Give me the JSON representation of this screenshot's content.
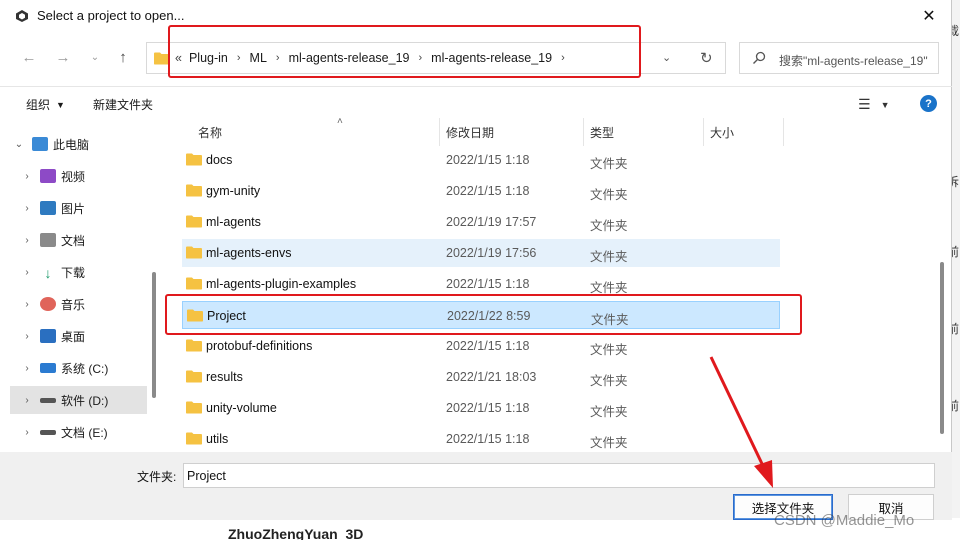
{
  "window": {
    "title": "Select a project to open..."
  },
  "address": {
    "lead": "«",
    "crumbs": [
      "Plug-in",
      "ML",
      "ml-agents-release_19",
      "ml-agents-release_19"
    ]
  },
  "search": {
    "placeholder": "搜索\"ml-agents-release_19\""
  },
  "toolbar": {
    "organize": "组织",
    "new_folder": "新建文件夹"
  },
  "navpane": {
    "items": [
      {
        "label": "此电脑",
        "icon": "computer-icon",
        "color": "#3a8ad6"
      },
      {
        "label": "视频",
        "icon": "video-icon",
        "color": "#8d4ac6"
      },
      {
        "label": "图片",
        "icon": "picture-icon",
        "color": "#2e7ac0"
      },
      {
        "label": "文档",
        "icon": "document-icon",
        "color": "#8a8a8a"
      },
      {
        "label": "下载",
        "icon": "download-icon",
        "color": "#1c9a6a"
      },
      {
        "label": "音乐",
        "icon": "music-icon",
        "color": "#e0645a"
      },
      {
        "label": "桌面",
        "icon": "desktop-icon",
        "color": "#2a6fc0"
      },
      {
        "label": "系统 (C:)",
        "icon": "drive-c-icon",
        "color": "#2b7bd1"
      },
      {
        "label": "软件 (D:)",
        "icon": "drive-d-icon",
        "color": "#555555"
      },
      {
        "label": "文档 (E:)",
        "icon": "drive-e-icon",
        "color": "#555555"
      }
    ]
  },
  "columns": {
    "name": "名称",
    "date": "修改日期",
    "type": "类型",
    "size": "大小"
  },
  "files": [
    {
      "name": "docs",
      "date": "2022/1/15 1:18",
      "type": "文件夹"
    },
    {
      "name": "gym-unity",
      "date": "2022/1/15 1:18",
      "type": "文件夹"
    },
    {
      "name": "ml-agents",
      "date": "2022/1/19 17:57",
      "type": "文件夹"
    },
    {
      "name": "ml-agents-envs",
      "date": "2022/1/19 17:56",
      "type": "文件夹"
    },
    {
      "name": "ml-agents-plugin-examples",
      "date": "2022/1/15 1:18",
      "type": "文件夹"
    },
    {
      "name": "Project",
      "date": "2022/1/22 8:59",
      "type": "文件夹"
    },
    {
      "name": "protobuf-definitions",
      "date": "2022/1/15 1:18",
      "type": "文件夹"
    },
    {
      "name": "results",
      "date": "2022/1/21 18:03",
      "type": "文件夹"
    },
    {
      "name": "unity-volume",
      "date": "2022/1/15 1:18",
      "type": "文件夹"
    },
    {
      "name": "utils",
      "date": "2022/1/15 1:18",
      "type": "文件夹"
    }
  ],
  "filename": {
    "label": "文件夹:",
    "value": "Project"
  },
  "buttons": {
    "select": "选择文件夹",
    "cancel": "取消"
  },
  "watermark": "CSDN @Maddie_Mo",
  "background": {
    "bottom_text": "ZhuoZhengYuan_3D",
    "right_frags": [
      "载",
      "诉",
      "前",
      "前",
      "前"
    ]
  },
  "colors": {
    "highlight": "#e0191d",
    "folder": "#f5c242",
    "selection": "#cce8ff",
    "accent": "#1a73c9"
  }
}
